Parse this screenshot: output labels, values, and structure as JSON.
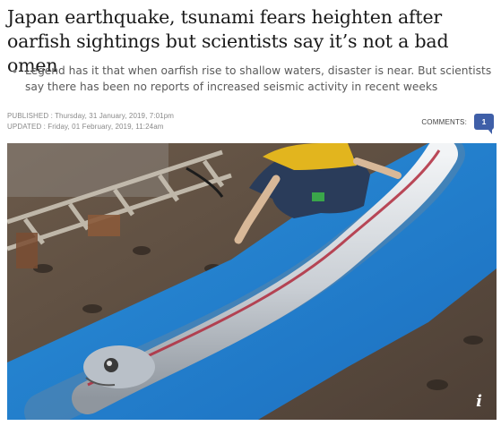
{
  "article": {
    "headline": "Japan earthquake, tsunami fears heighten after oarfish sightings but scientists say it’s not a bad omen",
    "summary": "Legend has it that when oarfish rise to shallow waters, disaster is near. But scientists say there has been no reports of increased seismic activity in recent weeks",
    "published": "PUBLISHED : Thursday, 31 January, 2019, 7:01pm",
    "updated": "UPDATED : Friday, 01 February, 2019, 11:24am"
  },
  "comments": {
    "label": "COMMENTS:",
    "count": "1",
    "badge_color": "#3f5fa8"
  },
  "photo": {
    "info_icon": "i"
  }
}
